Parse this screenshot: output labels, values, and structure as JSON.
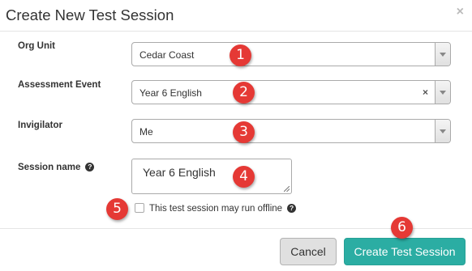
{
  "dialog": {
    "title": "Create New Test Session",
    "close_glyph": "×"
  },
  "form": {
    "org_unit": {
      "label": "Org Unit",
      "value": "Cedar Coast"
    },
    "assessment_event": {
      "label": "Assessment Event",
      "value": "Year 6 English",
      "clear_glyph": "×"
    },
    "invigilator": {
      "label": "Invigilator",
      "value": "Me"
    },
    "session_name": {
      "label": "Session name",
      "value": "Year 6 English",
      "help_glyph": "?"
    },
    "offline": {
      "label": "This test session may run offline",
      "checked": false,
      "help_glyph": "?"
    }
  },
  "buttons": {
    "cancel": "Cancel",
    "create": "Create Test Session"
  },
  "markers": [
    "1",
    "2",
    "3",
    "4",
    "5",
    "6"
  ],
  "colors": {
    "primary": "#2bada3",
    "marker": "#e53935",
    "cancel_bg": "#e0e0e0"
  }
}
